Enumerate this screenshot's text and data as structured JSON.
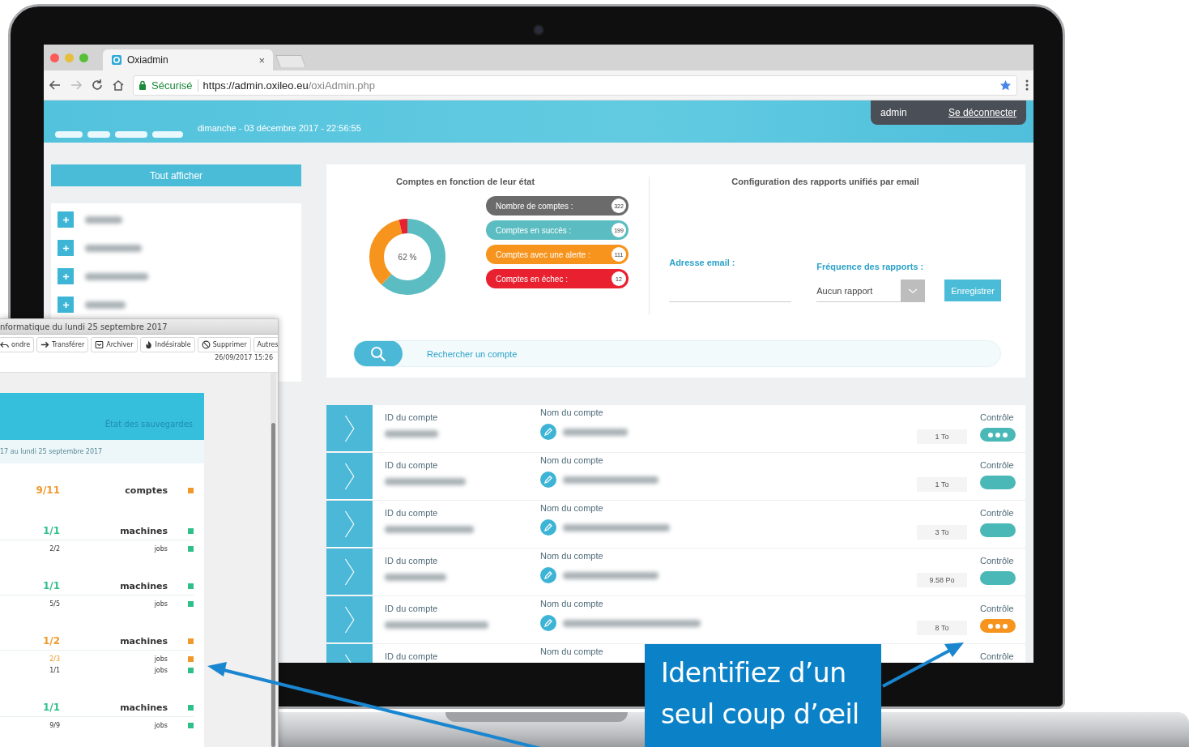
{
  "browser": {
    "tab_title": "Oxiadmin",
    "tab_close": "×",
    "security_label": "Sécurisé",
    "url_host": "https://admin.oxileo.eu",
    "url_path": "/oxiAdmin.php"
  },
  "header": {
    "datetime": "dimanche - 03 décembre 2017 - 22:56:55",
    "user": "admin",
    "logout": "Se déconnecter"
  },
  "sidebar": {
    "show_all": "Tout afficher",
    "items": [
      {
        "expanded": false
      },
      {
        "expanded": false
      },
      {
        "expanded": false
      },
      {
        "expanded": false
      }
    ]
  },
  "accounts_panel": {
    "title": "Comptes en fonction de leur état",
    "donut_label": "62 %",
    "stats": [
      {
        "kind": "total",
        "label": "Nombre de comptes :",
        "count": "322",
        "color": "#6b6b6b"
      },
      {
        "kind": "segment",
        "label": "Comptes en succès :",
        "count": "199",
        "color": "#5bbdc2"
      },
      {
        "kind": "segment",
        "label": "Comptes avec une alerte :",
        "count": "111",
        "color": "#f7941d"
      },
      {
        "kind": "segment",
        "label": "Comptes en échec :",
        "count": "12",
        "color": "#e8202f"
      }
    ]
  },
  "report_config": {
    "title": "Configuration des rapports unifiés par email",
    "email_label": "Adresse email :",
    "frequency_label": "Fréquence des rapports :",
    "frequency_value": "Aucun rapport",
    "save_button": "Enregistrer"
  },
  "search": {
    "placeholder": "Rechercher un compte"
  },
  "accounts": [
    {
      "id_label": "ID du compte",
      "name_label": "Nom du compte",
      "control_label": "Contrôle",
      "size": "1 To",
      "color": "#4bb8b8",
      "pending": true
    },
    {
      "id_label": "ID du compte",
      "name_label": "Nom du compte",
      "control_label": "Contrôle",
      "size": "1 To",
      "color": "#4bb8b8",
      "pending": false
    },
    {
      "id_label": "ID du compte",
      "name_label": "Nom du compte",
      "control_label": "Contrôle",
      "size": "3 To",
      "color": "#4bb8b8",
      "pending": false
    },
    {
      "id_label": "ID du compte",
      "name_label": "Nom du compte",
      "control_label": "Contrôle",
      "size": "9.58 Po",
      "color": "#4bb8b8",
      "pending": false
    },
    {
      "id_label": "ID du compte",
      "name_label": "Nom du compte",
      "control_label": "Contrôle",
      "size": "8 To",
      "color": "#f7941d",
      "pending": true
    },
    {
      "id_label": "ID du compte",
      "name_label": "Nom du compte",
      "control_label": "Contrôle"
    }
  ],
  "email_window": {
    "title": "nformatique du lundi 25 septembre 2017",
    "toolbar": [
      {
        "kind": "reply",
        "label": "ondre"
      },
      {
        "kind": "forward",
        "label": "Transférer"
      },
      {
        "kind": "archive",
        "label": "Archiver"
      },
      {
        "kind": "junk",
        "label": "Indésirable"
      },
      {
        "kind": "delete",
        "label": "Supprimer"
      },
      {
        "kind": "more",
        "label": "Autres"
      }
    ],
    "date": "26/09/2017 15:26",
    "report": {
      "title": "État des sauvegardes",
      "period": "17 au lundi 25 septembre 2017",
      "rows": [
        {
          "kind": "group",
          "value": "9/11",
          "label": "comptes",
          "color": "#f0982b"
        },
        {
          "kind": "group",
          "value": "1/1",
          "label": "machines",
          "color": "#2fc08a"
        },
        {
          "kind": "detail",
          "value": "2/2",
          "label": "jobs",
          "color": "#2fc08a"
        },
        {
          "kind": "group",
          "value": "1/1",
          "label": "machines",
          "color": "#2fc08a"
        },
        {
          "kind": "detail",
          "value": "5/5",
          "label": "jobs",
          "color": "#2fc08a"
        },
        {
          "kind": "group",
          "value": "1/2",
          "label": "machines",
          "color": "#f0982b"
        },
        {
          "kind": "alert_detail",
          "value": "2/3",
          "label": "jobs",
          "color": "#f0982b"
        },
        {
          "kind": "detail",
          "value": "1/1",
          "label": "jobs",
          "color": "#2fc08a"
        },
        {
          "kind": "group",
          "value": "1/1",
          "label": "machines",
          "color": "#2fc08a"
        },
        {
          "kind": "detail",
          "value": "9/9",
          "label": "jobs",
          "color": "#2fc08a"
        }
      ]
    }
  },
  "callout": {
    "text": "Identifiez d’un seul coup d’œil"
  }
}
